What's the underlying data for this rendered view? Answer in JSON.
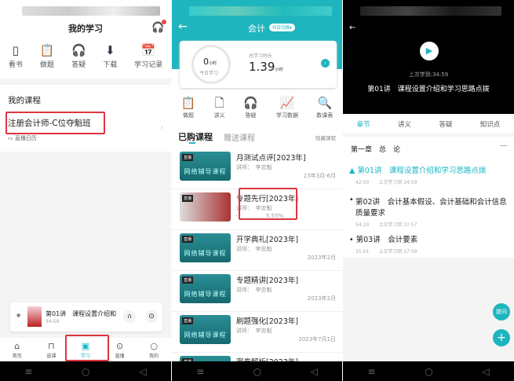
{
  "p1": {
    "title": "我的学习",
    "shortcuts": [
      "看书",
      "做题",
      "答疑",
      "下载",
      "学习记录"
    ],
    "section": "我的课程",
    "course": "注册会计师-C位夺魁班",
    "calendar": "直播日历",
    "player": {
      "title": "第01讲　课程设置介绍和",
      "time": "34:59"
    },
    "tabs": [
      "首页",
      "选课",
      "学习",
      "直播",
      "我的"
    ]
  },
  "p2": {
    "title": "会计",
    "switch": "科目切换",
    "today_value": "0",
    "today_unit": "小时",
    "today_label": "今日学习",
    "total_label": "总学习时长",
    "total_value": "1.39",
    "total_unit": "小时",
    "shortcuts": [
      "做题",
      "讲义",
      "答疑",
      "学习数据",
      "数课表"
    ],
    "tabs": [
      "已购课程",
      "赠送课程"
    ],
    "hide": "隐藏课程",
    "thumb_text": "网络辅导课程",
    "thumb_tag": "直播",
    "courses": [
      {
        "title": "月测试点评[2023年]",
        "lecturer": "讲师：　李忠魁",
        "date": "23年3月-6月"
      },
      {
        "title": "专题先行[2023年]",
        "lecturer": "讲师：　李忠魁",
        "progress": "5.55%"
      },
      {
        "title": "开学典礼[2023年]",
        "lecturer": "讲师：　李忠魁",
        "date": "2023年2月"
      },
      {
        "title": "专题精讲[2023年]",
        "lecturer": "讲师：　李忠魁",
        "date": "2023年2月"
      },
      {
        "title": "刷题强化[2023年]",
        "lecturer": "讲师：　李忠魁",
        "date": "2023年7月1日"
      },
      {
        "title": "密卷解析[2023年]",
        "lecturer": "",
        "date": ""
      }
    ]
  },
  "p3": {
    "last": "上次学到:34:59",
    "video_title": "第01讲　课程设置介绍和学习思路点拨",
    "tabs": [
      "章节",
      "讲义",
      "答疑",
      "知识点"
    ],
    "chapter": "第一章　总　论",
    "lessons": [
      {
        "name": "第01讲　课程设置介绍和学习思路点拨",
        "dur": "42:50",
        "last": "上次学习到 34:59"
      },
      {
        "name": "第02讲　会计基本假设、会计基础和会计信息质量要求",
        "dur": "54:20",
        "last": "上次学习到 37:57"
      },
      {
        "name": "第03讲　会计要素",
        "dur": "31:01",
        "last": "上次学习到 27:59"
      }
    ],
    "ask": "提问",
    "add": "+"
  }
}
